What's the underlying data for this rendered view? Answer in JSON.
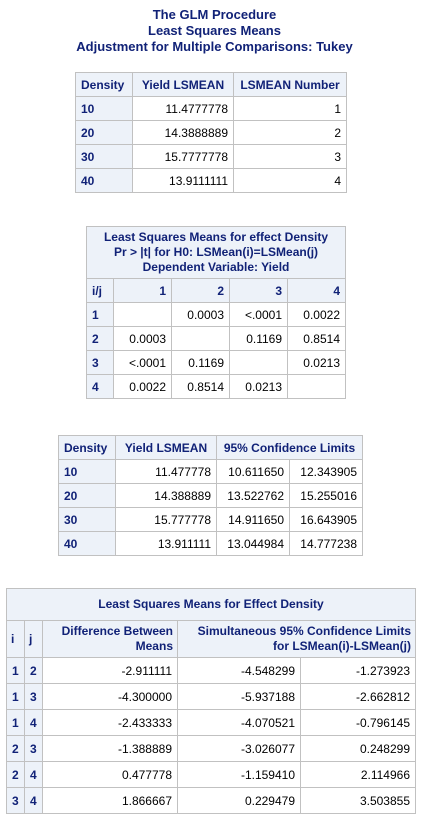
{
  "titles": {
    "line1": "The GLM Procedure",
    "line2": "Least Squares Means",
    "line3": "Adjustment for Multiple Comparisons: Tukey"
  },
  "lsmeans": {
    "headers": [
      "Density",
      "Yield LSMEAN",
      "LSMEAN Number"
    ],
    "rows": [
      [
        "10",
        "11.4777778",
        "1"
      ],
      [
        "20",
        "14.3888889",
        "2"
      ],
      [
        "30",
        "15.7777778",
        "3"
      ],
      [
        "40",
        "13.9111111",
        "4"
      ]
    ]
  },
  "pvalues": {
    "caption1": "Least Squares Means for effect Density",
    "caption2": "Pr > |t| for H0: LSMean(i)=LSMean(j)",
    "caption3": "Dependent Variable: Yield",
    "headers": [
      "i/j",
      "1",
      "2",
      "3",
      "4"
    ],
    "rows": [
      [
        "1",
        "",
        "0.0003",
        "<.0001",
        "0.0022"
      ],
      [
        "2",
        "0.0003",
        "",
        "0.1169",
        "0.8514"
      ],
      [
        "3",
        "<.0001",
        "0.1169",
        "",
        "0.0213"
      ],
      [
        "4",
        "0.0022",
        "0.8514",
        "0.0213",
        ""
      ]
    ]
  },
  "ci": {
    "headers": [
      "Density",
      "Yield LSMEAN",
      "95% Confidence Limits"
    ],
    "rows": [
      [
        "10",
        "11.477778",
        "10.611650",
        "12.343905"
      ],
      [
        "20",
        "14.388889",
        "13.522762",
        "15.255016"
      ],
      [
        "30",
        "15.777778",
        "14.911650",
        "16.643905"
      ],
      [
        "40",
        "13.911111",
        "13.044984",
        "14.777238"
      ]
    ]
  },
  "diffs": {
    "caption": "Least Squares Means for Effect Density",
    "headers": [
      "i",
      "j",
      "Difference Between Means",
      "Simultaneous 95% Confidence Limits for LSMean(i)-LSMean(j)"
    ],
    "rows": [
      [
        "1",
        "2",
        "-2.911111",
        "-4.548299",
        "-1.273923"
      ],
      [
        "1",
        "3",
        "-4.300000",
        "-5.937188",
        "-2.662812"
      ],
      [
        "1",
        "4",
        "-2.433333",
        "-4.070521",
        "-0.796145"
      ],
      [
        "2",
        "3",
        "-1.388889",
        "-3.026077",
        "0.248299"
      ],
      [
        "2",
        "4",
        "0.477778",
        "-1.159410",
        "2.114966"
      ],
      [
        "3",
        "4",
        "1.866667",
        "0.229479",
        "3.503855"
      ]
    ]
  }
}
